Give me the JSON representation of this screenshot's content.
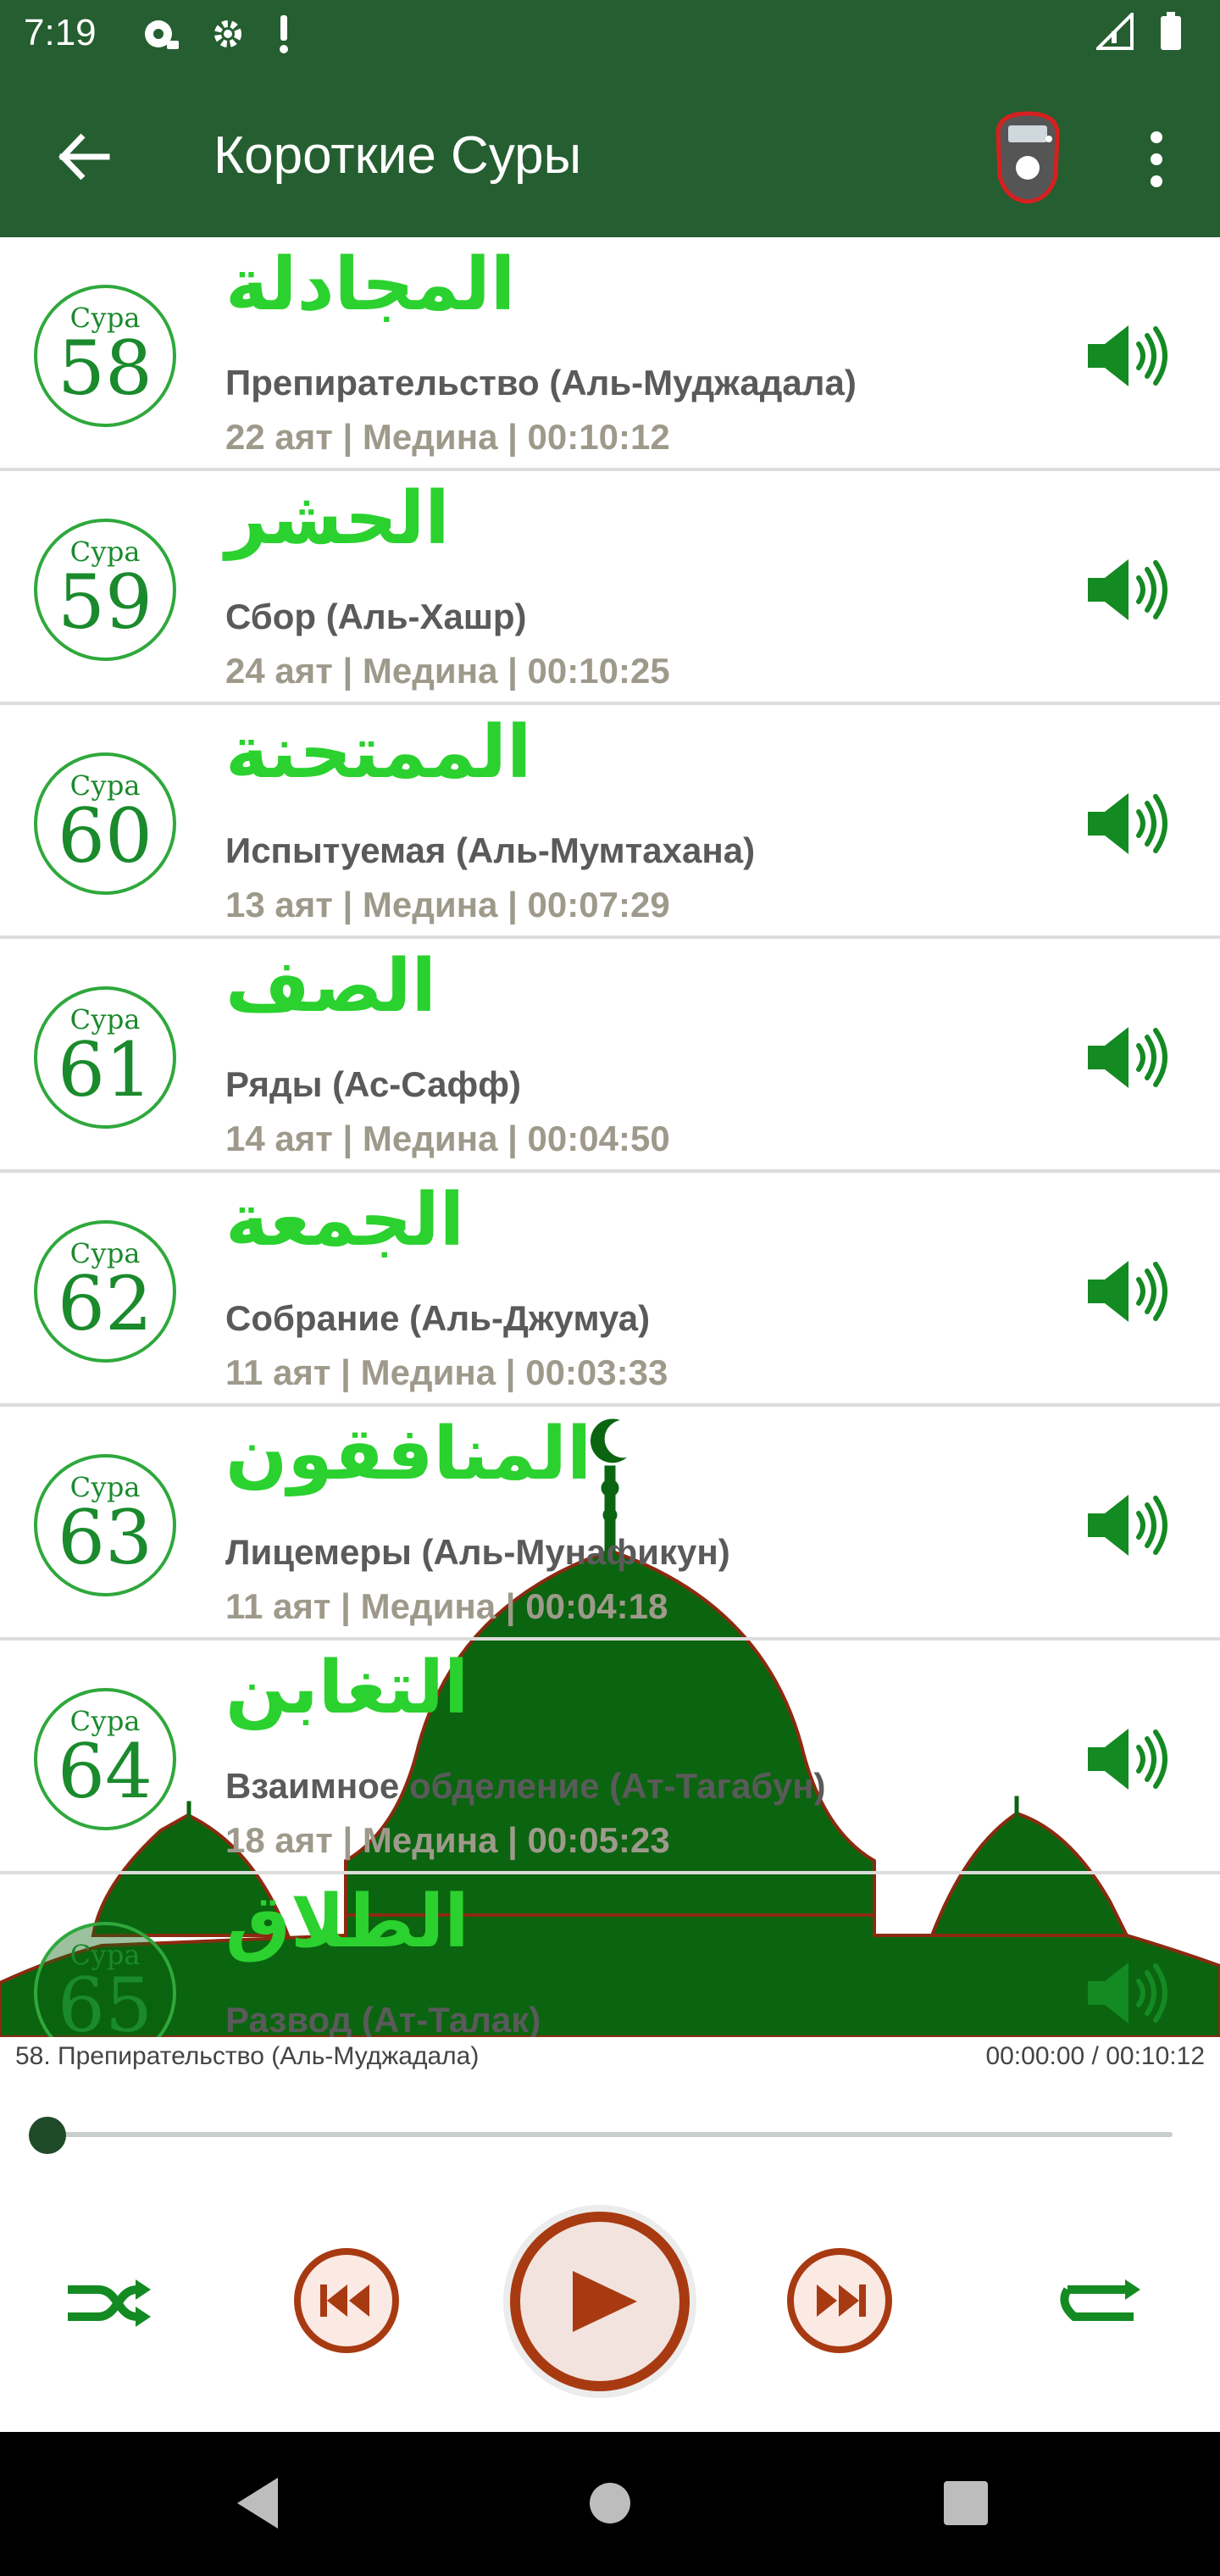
{
  "status_bar": {
    "time": "7:19",
    "left_icons": [
      "podcast-icon",
      "settings-icon",
      "alert-icon"
    ],
    "right_icons": [
      "signal-icon",
      "battery-icon"
    ]
  },
  "app_bar": {
    "title": "Короткие Суры",
    "back_icon": "arrow-left-icon",
    "counter_icon": "tasbih-counter-icon",
    "menu_icon": "more-vert-icon"
  },
  "colors": {
    "primary_green": "#255e30",
    "arabic_green": "#2bd12f",
    "badge_green": "#1a8a2c",
    "meta_gray": "#9e9a8b",
    "player_accent": "#a83a12",
    "mosque_green": "#0b6410"
  },
  "surahs": [
    {
      "badge_label": "Сура",
      "number": "58",
      "arabic": "المجادلة",
      "name": "Препирательство (Аль-Муджадала)",
      "meta": "22 аят | Медина | 00:10:12"
    },
    {
      "badge_label": "Сура",
      "number": "59",
      "arabic": "الحشر",
      "name": "Сбор (Аль-Хашр)",
      "meta": "24 аят | Медина | 00:10:25"
    },
    {
      "badge_label": "Сура",
      "number": "60",
      "arabic": "الممتحنة",
      "name": "Испытуемая (Аль-Мумтахана)",
      "meta": "13 аят | Медина | 00:07:29"
    },
    {
      "badge_label": "Сура",
      "number": "61",
      "arabic": "الصف",
      "name": "Ряды (Ас-Сафф)",
      "meta": "14 аят | Медина | 00:04:50"
    },
    {
      "badge_label": "Сура",
      "number": "62",
      "arabic": "الجمعة",
      "name": "Собрание (Аль-Джумуа)",
      "meta": "11 аят | Медина | 00:03:33"
    },
    {
      "badge_label": "Сура",
      "number": "63",
      "arabic": "المنافقون",
      "name": "Лицемеры (Аль-Мунафикун)",
      "meta": "11 аят | Медина | 00:04:18"
    },
    {
      "badge_label": "Сура",
      "number": "64",
      "arabic": "التغابن",
      "name": "Взаимное обделение (Ат-Тагабун)",
      "meta": "18 аят | Медина | 00:05:23"
    },
    {
      "badge_label": "Сура",
      "number": "65",
      "arabic": "الطلاق",
      "name": "Развод (Ат-Талак)",
      "meta": ""
    }
  ],
  "player": {
    "now_playing": "58. Препирательство (Аль-Муджадала)",
    "time": "00:00:00 / 00:10:12",
    "progress_fraction": 0.0,
    "shuffle_icon": "shuffle-icon",
    "prev_icon": "skip-previous-icon",
    "play_icon": "play-icon",
    "next_icon": "skip-next-icon",
    "repeat_icon": "repeat-icon"
  },
  "nav_bar": {
    "back_icon": "nav-back-icon",
    "home_icon": "nav-home-icon",
    "recents_icon": "nav-recents-icon"
  }
}
